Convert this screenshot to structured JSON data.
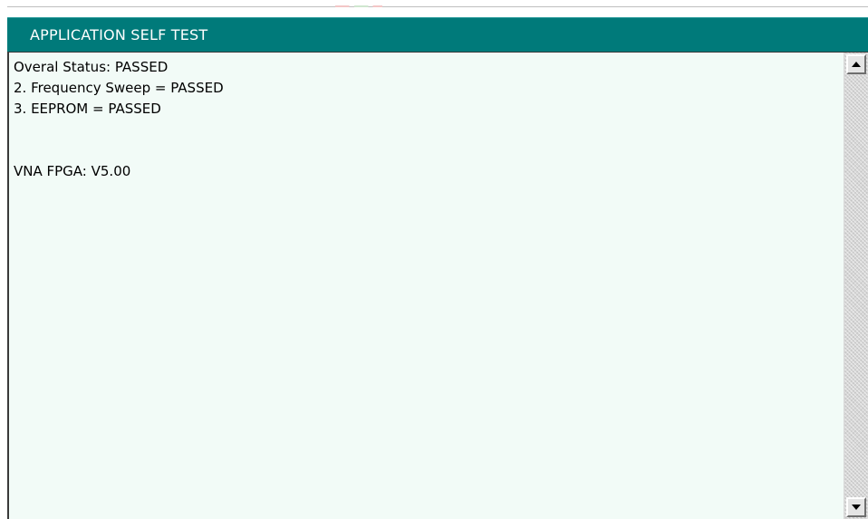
{
  "window": {
    "title": "APPLICATION SELF TEST"
  },
  "results": {
    "lines": [
      "Overal Status: PASSED",
      "2. Frequency Sweep = PASSED",
      "3. EEPROM = PASSED",
      "",
      "",
      "VNA FPGA: V5.00"
    ]
  },
  "scrollbar": {
    "up_icon": "arrow-up-icon",
    "down_icon": "arrow-down-icon"
  },
  "colors": {
    "title_bar": "#007a7a",
    "title_text": "#ffffff",
    "panel_background": "#f2fbf7",
    "scrollbar_track": "#d6d6d6"
  }
}
